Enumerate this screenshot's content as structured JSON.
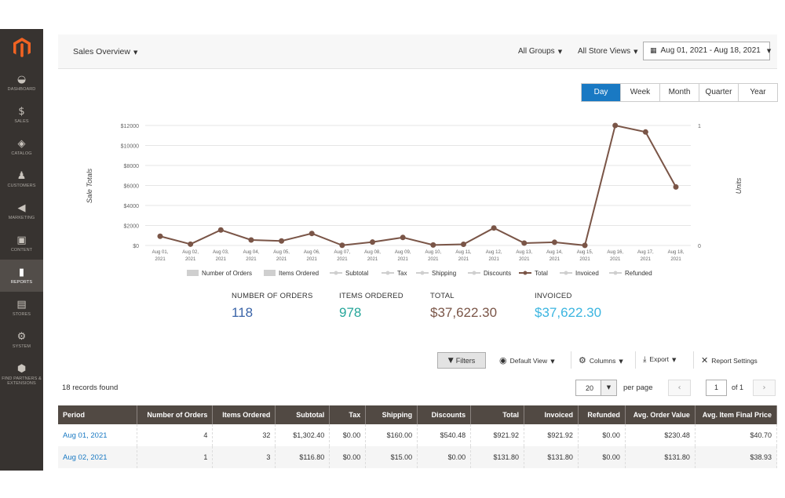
{
  "sidebar": {
    "items": [
      {
        "label": "DASHBOARD",
        "icon": "dashboard-icon"
      },
      {
        "label": "SALES",
        "icon": "dollar-icon"
      },
      {
        "label": "CATALOG",
        "icon": "cube-icon"
      },
      {
        "label": "CUSTOMERS",
        "icon": "person-icon"
      },
      {
        "label": "MARKETING",
        "icon": "megaphone-icon"
      },
      {
        "label": "CONTENT",
        "icon": "layout-icon"
      },
      {
        "label": "REPORTS",
        "icon": "bar-chart-icon",
        "active": true
      },
      {
        "label": "STORES",
        "icon": "store-icon"
      },
      {
        "label": "SYSTEM",
        "icon": "gear-icon"
      },
      {
        "label": "FIND PARTNERS & EXTENSIONS",
        "icon": "puzzle-icon"
      }
    ]
  },
  "header": {
    "title": "Sales Overview",
    "groups": "All Groups",
    "store_views": "All Store Views",
    "date_range": "Aug 01, 2021 - Aug 18, 2021"
  },
  "period_tabs": [
    "Day",
    "Week",
    "Month",
    "Quarter",
    "Year"
  ],
  "chart_data": {
    "type": "line",
    "categories": [
      "Aug 01, 2021",
      "Aug 02, 2021",
      "Aug 03, 2021",
      "Aug 04, 2021",
      "Aug 05, 2021",
      "Aug 06, 2021",
      "Aug 07, 2021",
      "Aug 08, 2021",
      "Aug 09, 2021",
      "Aug 10, 2021",
      "Aug 11, 2021",
      "Aug 12, 2021",
      "Aug 13, 2021",
      "Aug 14, 2021",
      "Aug 15, 2021",
      "Aug 16, 2021",
      "Aug 17, 2021",
      "Aug 18, 2021"
    ],
    "series": [
      {
        "name": "Total",
        "color": "#7a5547",
        "values": [
          921.92,
          131.8,
          1550,
          550,
          450,
          1200,
          20,
          340,
          800,
          50,
          120,
          1750,
          240,
          320,
          10,
          12000,
          11350,
          5850
        ]
      }
    ],
    "ylabel": "Sale Totals",
    "y2label": "Units",
    "ylim": [
      0,
      12000
    ],
    "yticks": [
      "$0",
      "$2000",
      "$4000",
      "$6000",
      "$8000",
      "$10000",
      "$12000"
    ],
    "y2ticks": [
      "0",
      "1"
    ],
    "grid": true,
    "legend": [
      "Number of Orders",
      "Items Ordered",
      "Subtotal",
      "Tax",
      "Shipping",
      "Discounts",
      "Total",
      "Invoiced",
      "Refunded"
    ]
  },
  "totals": [
    {
      "label": "NUMBER OF ORDERS",
      "value": "118",
      "color": "#3a64a8"
    },
    {
      "label": "ITEMS ORDERED",
      "value": "978",
      "color": "#26a69a"
    },
    {
      "label": "TOTAL",
      "value": "$37,622.30",
      "color": "#7a5547"
    },
    {
      "label": "INVOICED",
      "value": "$37,622.30",
      "color": "#3bb5e0"
    }
  ],
  "toolbar": {
    "filters": "Filters",
    "default_view": "Default View",
    "columns": "Columns",
    "export": "Export",
    "report_settings": "Report Settings"
  },
  "grid": {
    "records": "18 records found",
    "per_page_value": "20",
    "per_page_label": "per page",
    "page": "1",
    "page_of": "of 1",
    "columns": [
      "Period",
      "Number of Orders",
      "Items Ordered",
      "Subtotal",
      "Tax",
      "Shipping",
      "Discounts",
      "Total",
      "Invoiced",
      "Refunded",
      "Avg. Order Value",
      "Avg. Item Final Price"
    ],
    "rows": [
      [
        "Aug 01, 2021",
        "4",
        "32",
        "$1,302.40",
        "$0.00",
        "$160.00",
        "$540.48",
        "$921.92",
        "$921.92",
        "$0.00",
        "$230.48",
        "$40.70"
      ],
      [
        "Aug 02, 2021",
        "1",
        "3",
        "$116.80",
        "$0.00",
        "$15.00",
        "$0.00",
        "$131.80",
        "$131.80",
        "$0.00",
        "$131.80",
        "$38.93"
      ]
    ]
  }
}
